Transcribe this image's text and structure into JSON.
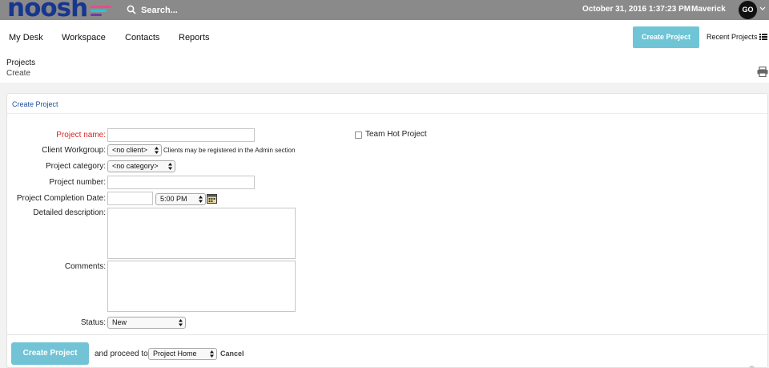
{
  "app": {
    "logo_text": "noosh",
    "logo_bar_colors": [
      "#e84b8a",
      "#2ec3d6",
      "#6a3ea1"
    ]
  },
  "header": {
    "search": {
      "placeholder": "Search...",
      "icon": "search-icon"
    },
    "datetime": "October 31, 2016 1:37:23 PM",
    "user_name": "Maverick",
    "avatar_initials": "GO"
  },
  "nav": {
    "items": [
      "My Desk",
      "Workspace",
      "Contacts",
      "Reports"
    ],
    "create_project_label": "Create Project",
    "recent_projects_label": "Recent Projects"
  },
  "breadcrumb": {
    "section": "Projects",
    "page": "Create"
  },
  "form": {
    "title": "Create Project",
    "project_name": {
      "label": "Project name:",
      "value": ""
    },
    "team_hot": {
      "label": "Team Hot Project",
      "checked": false
    },
    "client_workgroup": {
      "label": "Client Workgroup:",
      "selected": "<no client>",
      "hint": "Clients may be registered in the Admin section"
    },
    "project_category": {
      "label": "Project category:",
      "selected": "<no category>"
    },
    "project_number": {
      "label": "Project number:",
      "value": ""
    },
    "completion_date": {
      "label": "Project Completion Date:",
      "date_value": "",
      "time_selected": "5:00 PM"
    },
    "detailed_description": {
      "label": "Detailed description:",
      "value": ""
    },
    "comments": {
      "label": "Comments:",
      "value": ""
    },
    "status": {
      "label": "Status:",
      "selected": "New"
    }
  },
  "footer": {
    "create_label": "Create Project",
    "proceed_text": "and proceed to",
    "proceed_selected": "Project Home",
    "cancel_label": "Cancel"
  },
  "colors": {
    "accent": "#6fc5d6",
    "required": "#d42828",
    "brand": "#17368f",
    "topbar": "#8a8a8a"
  }
}
